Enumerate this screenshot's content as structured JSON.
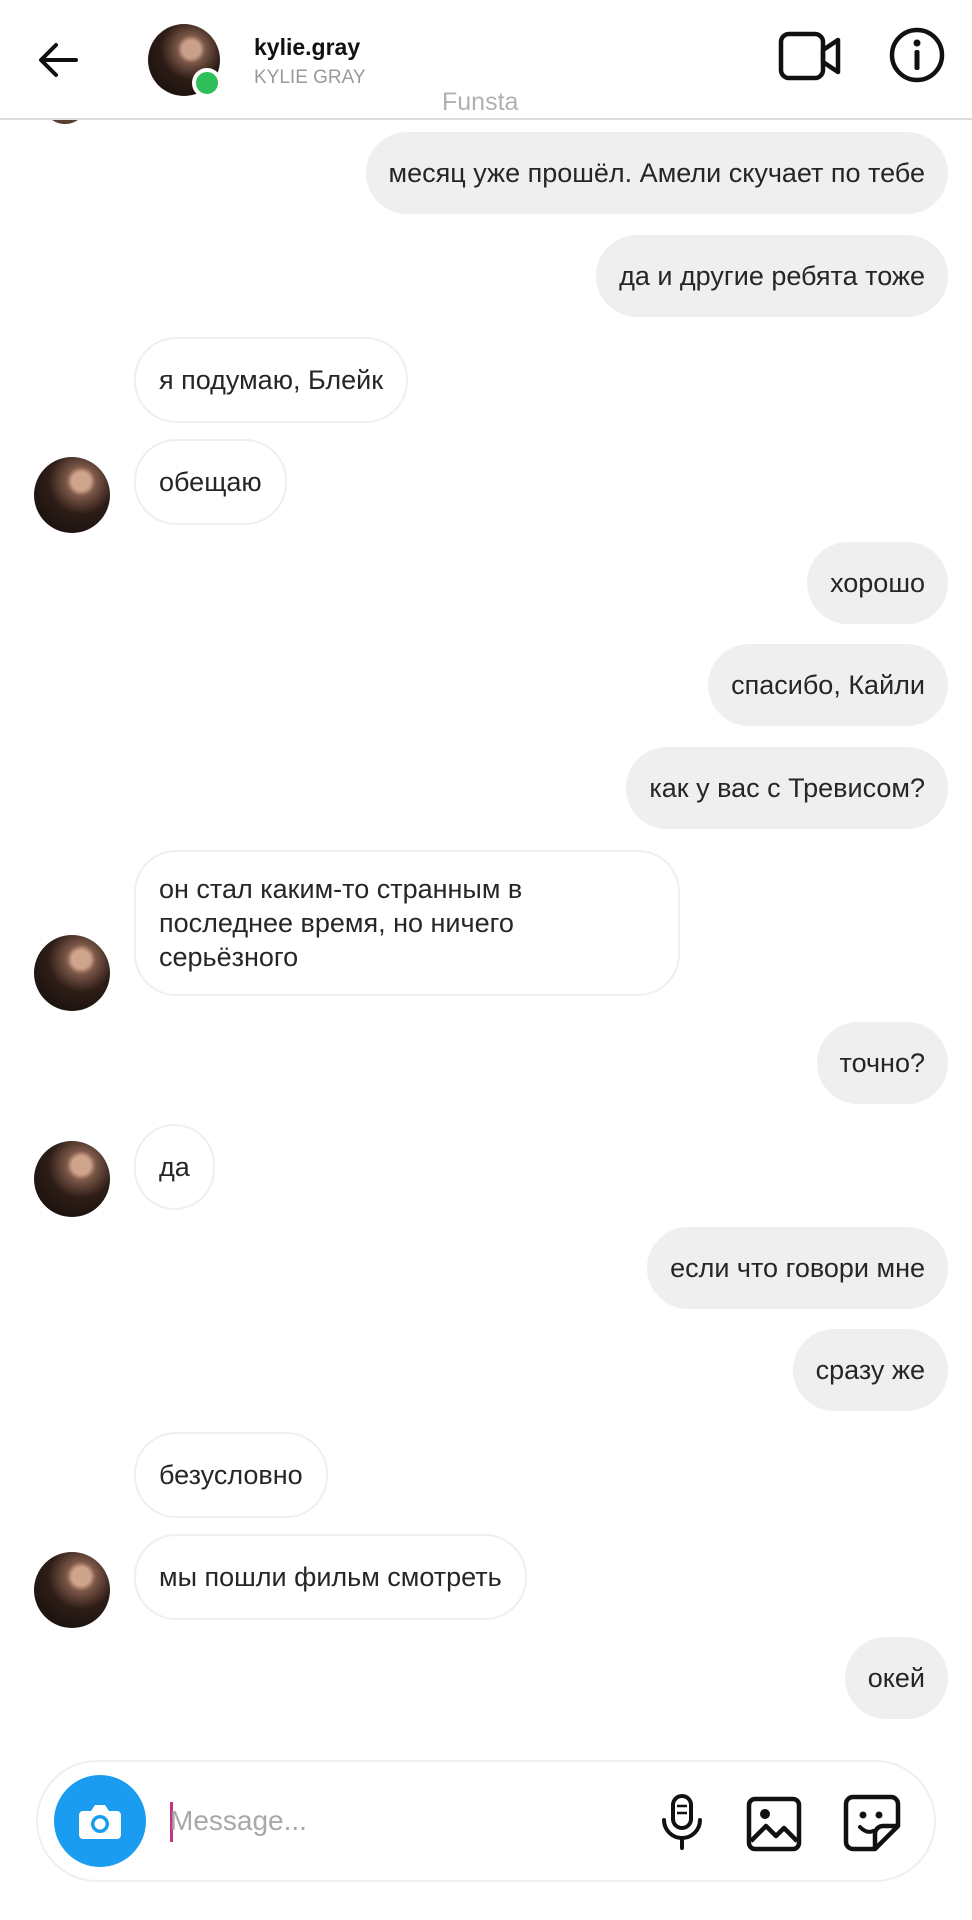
{
  "header": {
    "back_icon": "arrow-left-icon",
    "username": "kylie.gray",
    "full_name": "KYLIE GRAY",
    "subtitle": "Funsta",
    "video_icon": "video-camera-icon",
    "info_icon": "info-icon",
    "online_color": "#2fbf5a"
  },
  "messages": [
    {
      "dir": "out",
      "text": "месяц уже прошёл. Амели скучает по тебе"
    },
    {
      "dir": "out",
      "text": "да и другие ребята тоже"
    },
    {
      "dir": "in",
      "text": "я подумаю, Блейк"
    },
    {
      "dir": "in",
      "text": "обещаю"
    },
    {
      "dir": "out",
      "text": "хорошо"
    },
    {
      "dir": "out",
      "text": "спасибо, Кайли"
    },
    {
      "dir": "out",
      "text": "как у вас с Тревисом?"
    },
    {
      "dir": "in",
      "text": "он стал каким-то странным в последнее время,  но ничего серьёзного"
    },
    {
      "dir": "out",
      "text": "точно?"
    },
    {
      "dir": "in",
      "text": "да"
    },
    {
      "dir": "out",
      "text": "если что говори мне"
    },
    {
      "dir": "out",
      "text": "сразу же"
    },
    {
      "dir": "in",
      "text": "безусловно"
    },
    {
      "dir": "in",
      "text": "мы пошли фильм смотреть"
    },
    {
      "dir": "out",
      "text": "окей"
    }
  ],
  "composer": {
    "placeholder": "Message...",
    "camera_icon": "camera-icon",
    "mic_icon": "microphone-icon",
    "gallery_icon": "image-gallery-icon",
    "sticker_icon": "sticker-icon",
    "camera_color": "#1a9cf0"
  },
  "colors": {
    "outgoing_bubble": "#efefef",
    "incoming_border": "#efefef",
    "text": "#262626"
  }
}
